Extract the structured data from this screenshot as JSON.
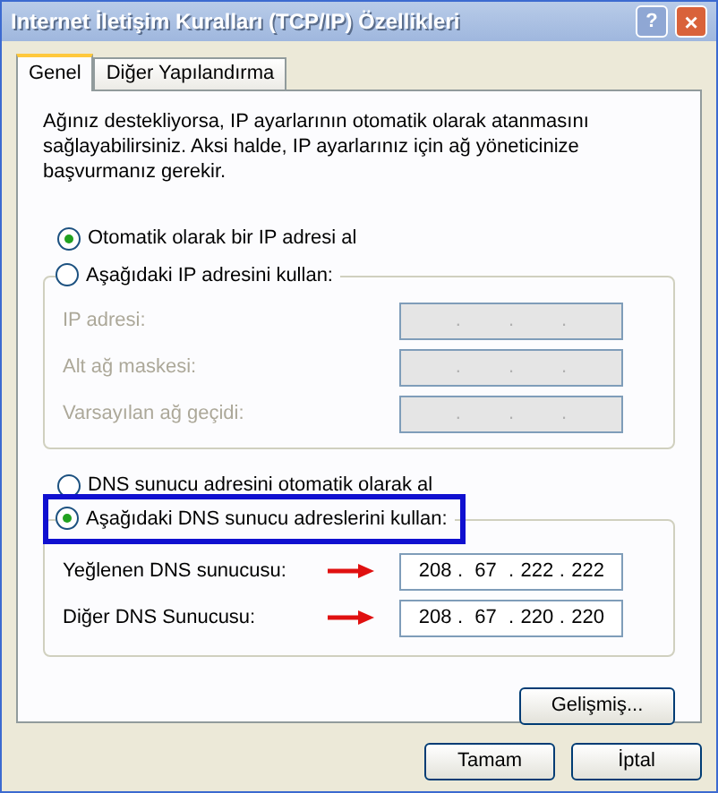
{
  "window": {
    "title": "Internet İletişim Kuralları (TCP/IP) Özellikleri",
    "help": "?",
    "close": "×"
  },
  "tabs": [
    {
      "label": "Genel",
      "selected": true
    },
    {
      "label": "Diğer Yapılandırma",
      "selected": false
    }
  ],
  "description": "Ağınız destekliyorsa, IP ayarlarının otomatik olarak atanmasını sağlayabilirsiniz. Aksi halde, IP ayarlarınız için ağ yöneticinize başvurmanız gerekir.",
  "separator": ".",
  "ip_section": {
    "options": [
      {
        "label": "Otomatik olarak bir IP adresi al",
        "selected": true
      },
      {
        "label": "Aşağıdaki IP adresini kullan:",
        "selected": false
      }
    ],
    "fields": [
      {
        "label": "IP adresi:",
        "disabled": true
      },
      {
        "label": "Alt ağ maskesi:",
        "disabled": true
      },
      {
        "label": "Varsayılan ağ geçidi:",
        "disabled": true
      }
    ]
  },
  "dns_section": {
    "options": [
      {
        "label": "DNS sunucu adresini otomatik olarak al",
        "selected": false,
        "highlighted": false
      },
      {
        "label": "Aşağıdaki DNS sunucu adreslerini kullan:",
        "selected": true,
        "highlighted": true
      }
    ],
    "fields": [
      {
        "label": "Yeğlenen DNS sunucusu:",
        "disabled": false,
        "arrow": true,
        "octets": [
          "208",
          "67",
          "222",
          "222"
        ]
      },
      {
        "label": "Diğer DNS Sunucusu:",
        "disabled": false,
        "arrow": true,
        "octets": [
          "208",
          "67",
          "220",
          "220"
        ]
      }
    ]
  },
  "advanced_button": "Gelişmiş...",
  "buttons": [
    "Tamam",
    "İptal"
  ]
}
